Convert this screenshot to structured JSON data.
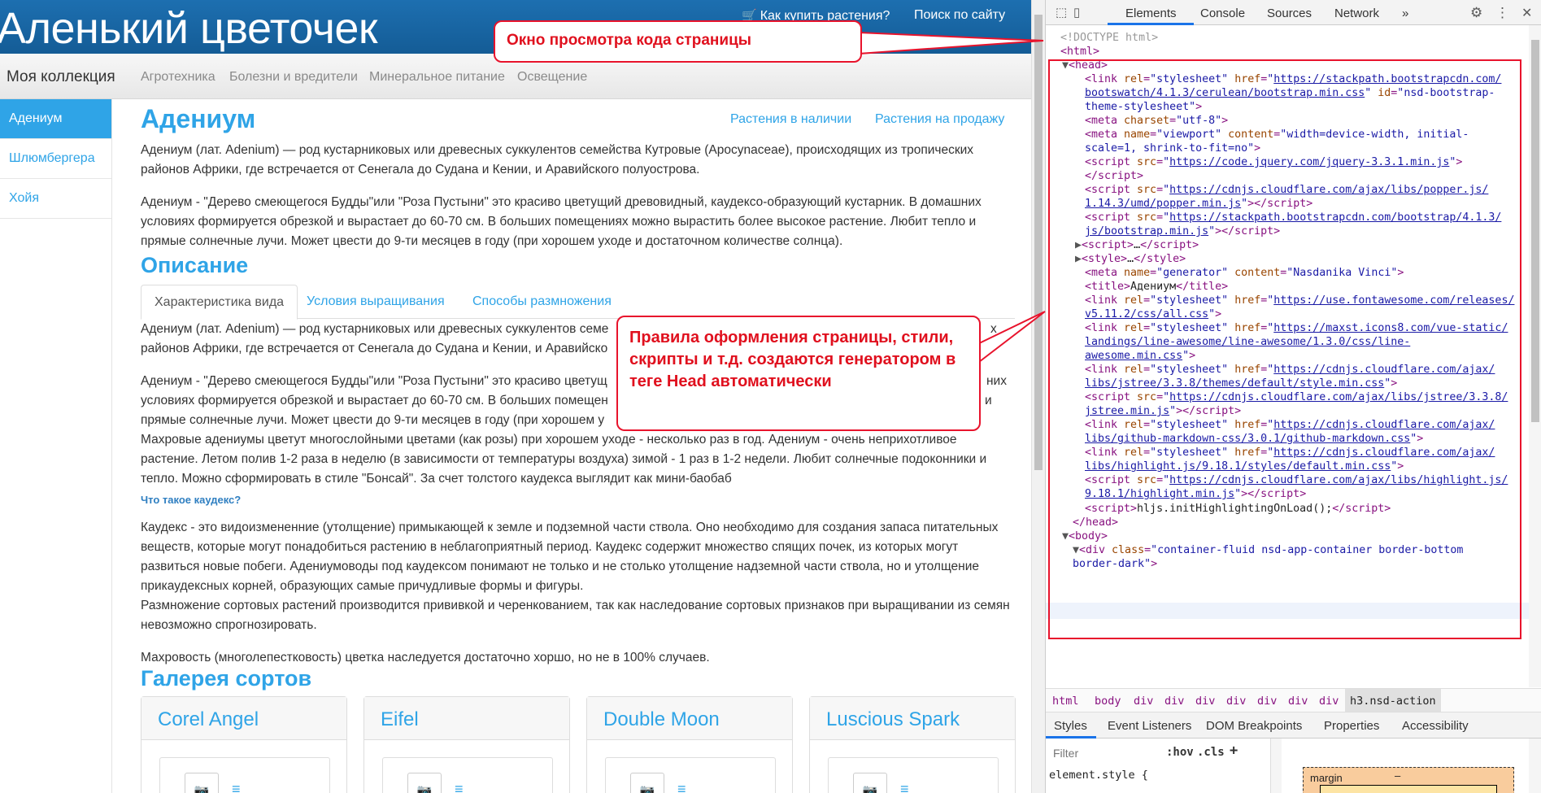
{
  "site": {
    "brand": "Аленький цветочек",
    "how_to_buy": "Как купить растения?",
    "search": "Поиск по сайту",
    "cart_glyph": "🛒"
  },
  "navbar": {
    "brand": "Моя коллекция",
    "items": [
      "Агротехника",
      "Болезни и вредители",
      "Минеральное питание",
      "Освещение"
    ]
  },
  "sidebar": {
    "items": [
      "Адениум",
      "Шлюмбергера",
      "Хойя"
    ]
  },
  "content": {
    "title": "Адениум",
    "link_stock": "Растения в наличии",
    "link_sale": "Растения на продажу",
    "p1": "Адениум (лат. Adenium) — род кустарниковых или древесных суккулентов семейства Кутровые (Apocynaceae), происходящих из тропических районов Африки, где встречается от Сенегала до Судана и Кении, и Аравийского полуострова.",
    "p2": "Адениум - \"Дерево смеющегося Будды\"или \"Роза Пустыни\" это красиво цветущий древовидный, каудексо-образующий кустарник. В домашних условиях формируется обрезкой и вырастает до 60-70 см. В больших помещениях можно вырастить более высокое растение. Любит тепло и прямые солнечные лучи. Может цвести до 9-ти месяцев в году (при хорошем уходе и достаточном количестве солнца).",
    "description_heading": "Описание",
    "tabs": [
      "Характеристика вида",
      "Условия выращивания",
      "Способы размножения"
    ],
    "t1_line1": "Адениум (лат. Adenium) — род кустарниковых или древесных суккулентов семе",
    "t1_line1_end": "х",
    "t1_line2": "районов Африки, где встречается от Сенегала до Судана и Кении, и Аравийско",
    "t2_line1": "Адениум - \"Дерево смеющегося Будды\"или \"Роза Пустыни\" это красиво цветущ",
    "t2_line1_end": "них",
    "t2_line2": "условиях формируется обрезкой и вырастает до 60-70 см. В больших помещен",
    "t2_line2_end": "и",
    "t2_line3": "прямые солнечные лучи. Может цвести до 9-ти месяцев в году (при хорошем у",
    "p_terry": "Махровые адениумы цветут многослойными цветами (как розы) при хорошем уходе - несколько раз в год. Адениум - очень неприхотливое растение. Летом полив 1-2 раза в неделю (в зависимости от температуры воздуха) зимой - 1 раз в 1-2 недели. Любит солнечные подоконники и тепло. Можно сформировать в стиле \"Бонсай\". За счет толстого каудекса выглядит как мини-баобаб",
    "caudex_q": "Что такое каудекс?",
    "p_caudex": "Каудекс - это видоизмененние (утолщение) примыкающей к земле и подземной части ствола. Оно необходимо для создания запаса питательных веществ, которые могут понадобиться растению в неблагоприятный период. Каудекс содержит множество спящих почек, из которых могут развиться новые побеги. Адениумоводы под каудексом понимают не только и не столько утолщение надземной части ствола, но и утолщение прикаудексных корней, образующих самые причудливые формы и фигуры.",
    "p_breed": "Размножение сортовых растений производится прививкой и черенкованием, так как наследование сортовых признаков при выращивании из семян невозможно спрогнозировать.",
    "p_double": "Махровость (многолепестковость) цветка наследуется достаточно хоршо, но не в 100% случаев.",
    "gallery_heading": "Галерея сортов",
    "cards": [
      "Corel Angel",
      "Eifel",
      "Double Moon",
      "Luscious Spark"
    ]
  },
  "callouts": {
    "c1": "Окно просмотра кода страницы",
    "c2": "Правила оформления страницы, стили, скрипты и т.д. создаются генератором в теге Head автоматически"
  },
  "devtools": {
    "tabs": [
      "Elements",
      "Console",
      "Sources",
      "Network",
      "»"
    ],
    "breadcrumbs": [
      "html",
      "body",
      "div",
      "div",
      "div",
      "div",
      "div",
      "div",
      "div",
      "h3.nsd-action"
    ],
    "panel_tabs": [
      "Styles",
      "Event Listeners",
      "DOM Breakpoints",
      "Properties",
      "Accessibility"
    ],
    "filter_placeholder": "Filter",
    "hov": ":hov",
    "cls": ".cls",
    "element_style": "element.style {",
    "margin_label": "margin",
    "margin_value": "–"
  },
  "dom": {
    "doctype": "<!DOCTYPE html>",
    "html_open": "<html>",
    "head_open": "<head>",
    "head_close": "</head>",
    "body_open": "<body>",
    "url_bootswatch_1": "https://stackpath.bootstrapcdn.com/",
    "url_bootswatch_2": "bootswatch/4.1.3/cerulean/bootstrap.min.css",
    "id_bootstrap_1": "nsd-bootstrap-",
    "id_bootstrap_2": "theme-stylesheet",
    "charset": "utf-8",
    "viewport_1": "width=device-width, initial-",
    "viewport_2": "scale=1, shrink-to-fit=no",
    "url_jquery": "https://code.jquery.com/jquery-3.3.1.min.js",
    "url_popper_1": "https://cdnjs.cloudflare.com/ajax/libs/popper.js/",
    "url_popper_2": "1.14.3/umd/popper.min.js",
    "url_bsjs_1": "https://stackpath.bootstrapcdn.com/bootstrap/4.1.3/",
    "url_bsjs_2": "js/bootstrap.min.js",
    "generator": "Nasdanika Vinci",
    "title": "Адениум",
    "url_fa_1": "https://use.fontawesome.com/releases/",
    "url_fa_2": "v5.11.2/css/all.css",
    "url_la_1": "https://maxst.icons8.com/vue-static/",
    "url_la_2": "landings/line-awesome/line-awesome/1.3.0/css/line-",
    "url_la_3": "awesome.min.css",
    "url_jst_1": "https://cdnjs.cloudflare.com/ajax/",
    "url_jst_2": "libs/jstree/3.3.8/themes/default/style.min.css",
    "url_jstjs_1": "https://cdnjs.cloudflare.com/ajax/libs/jstree/3.3.8/",
    "url_jstjs_2": "jstree.min.js",
    "url_gh_1": "https://cdnjs.cloudflare.com/ajax/",
    "url_gh_2": "libs/github-markdown-css/3.0.1/github-markdown.css",
    "url_hl_1": "https://cdnjs.cloudflare.com/ajax/",
    "url_hl_2": "libs/highlight.js/9.18.1/styles/default.min.css",
    "url_hljs_1": "https://cdnjs.cloudflare.com/ajax/libs/highlight.js/",
    "url_hljs_2": "9.18.1/highlight.min.js",
    "hljs_init": "hljs.initHighlightingOnLoad();",
    "div_class_1": "container-fluid nsd-app-container border-bottom",
    "div_class_2": "border-dark"
  }
}
